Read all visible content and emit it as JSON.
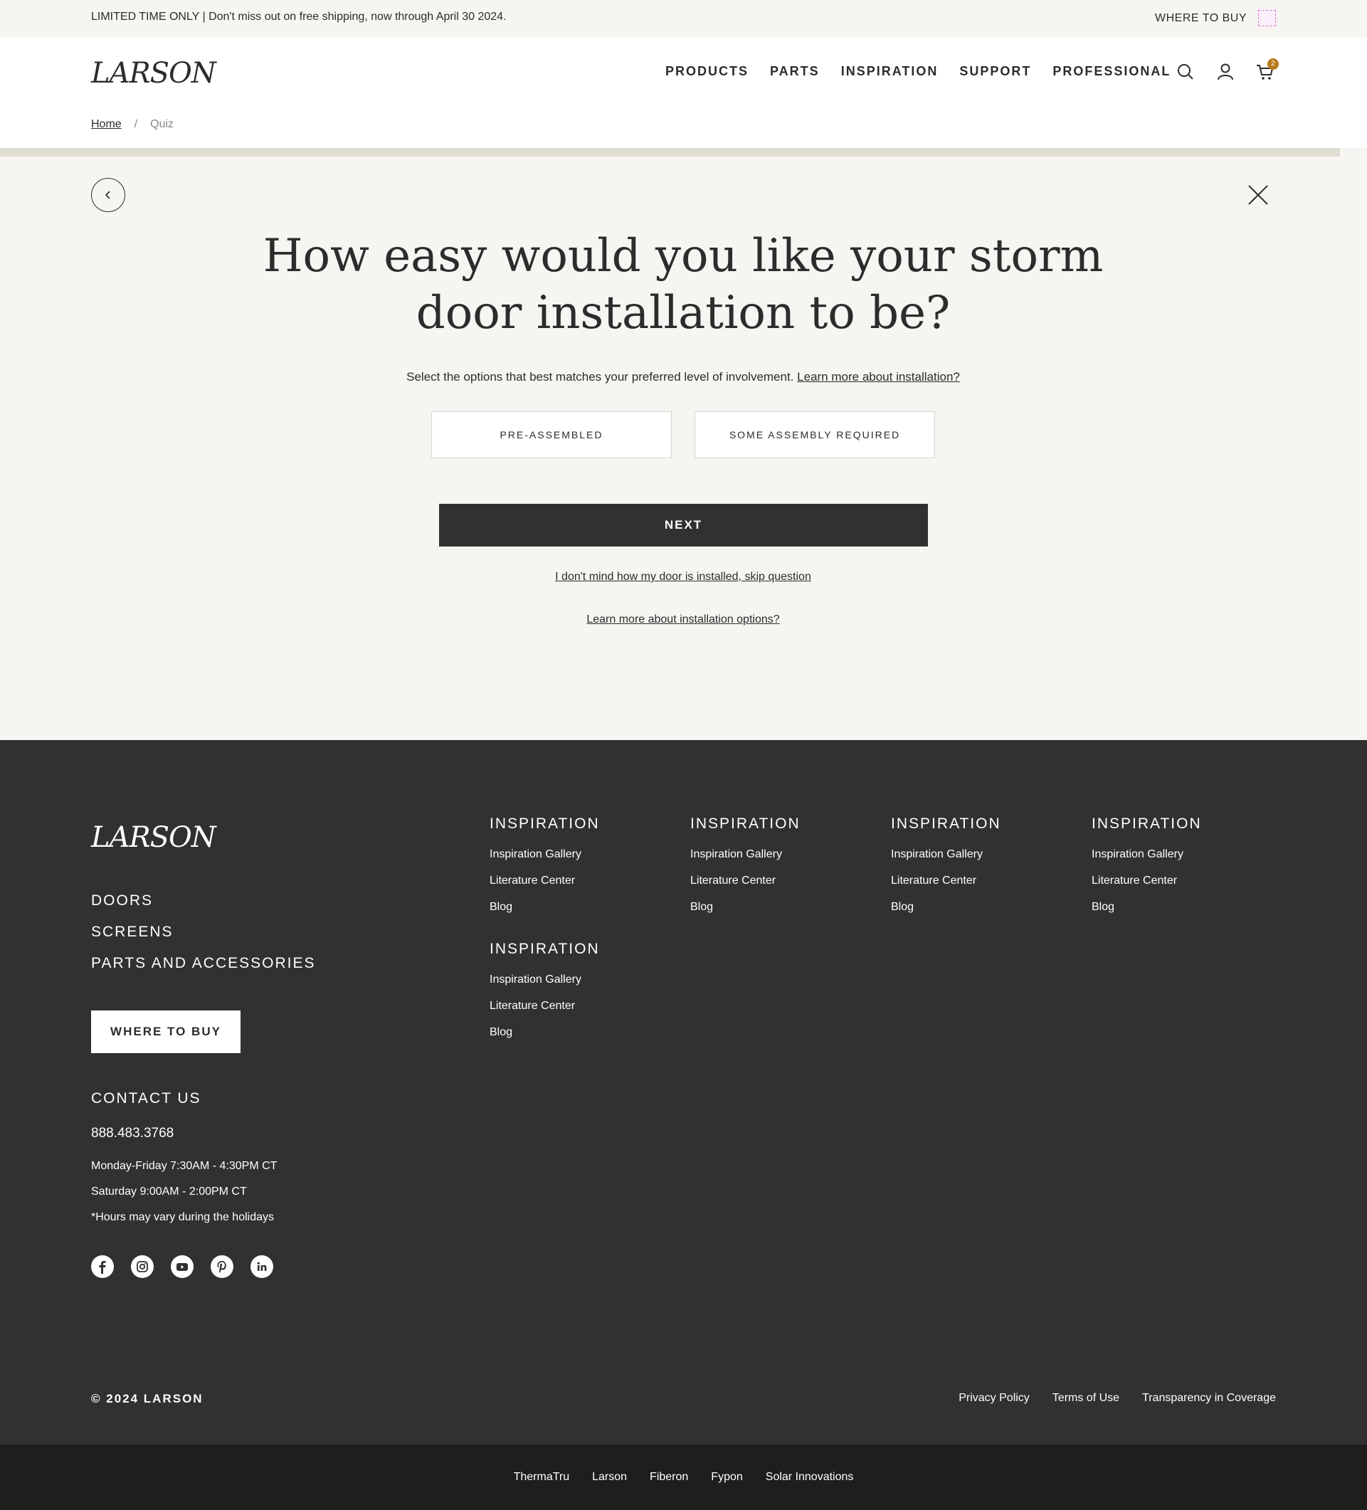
{
  "promo": {
    "text": "LIMITED TIME ONLY | Don't miss out on free shipping, now through April 30 2024.",
    "where_to_buy": "WHERE TO BUY"
  },
  "header": {
    "logo": "LARSON",
    "nav": [
      "PRODUCTS",
      "PARTS",
      "INSPIRATION",
      "SUPPORT",
      "PROFESSIONAL"
    ],
    "cart_count": "2",
    "icons": [
      "search-icon",
      "user-icon",
      "cart-icon"
    ]
  },
  "breadcrumb": {
    "home": "Home",
    "separator": "/",
    "current": "Quiz"
  },
  "quiz": {
    "progress": 0.98,
    "question": "How easy would you like your storm door installation to be?",
    "subtext": "Select the options that best matches your preferred level of involvement.",
    "subtext_link": "Learn more about installation?",
    "options": [
      "PRE-ASSEMBLED",
      "SOME ASSEMBLY REQUIRED"
    ],
    "next_label": "NEXT",
    "skip_label": "I don't mind how my door is installed, skip question",
    "learn_label": "Learn more about installation options?"
  },
  "footer": {
    "logo": "LARSON",
    "categories": [
      "DOORS",
      "SCREENS",
      "PARTS AND ACCESSORIES"
    ],
    "where_to_buy": "WHERE TO BUY",
    "contact_heading": "CONTACT US",
    "phone": "888.483.3768",
    "hours": [
      "Monday-Friday 7:30AM - 4:30PM CT",
      "Saturday 9:00AM - 2:00PM CT",
      "*Hours may vary during the holidays"
    ],
    "social": [
      "facebook-icon",
      "instagram-icon",
      "youtube-icon",
      "pinterest-icon",
      "linkedin-icon"
    ],
    "columns": [
      {
        "heading": "INSPIRATION",
        "links": [
          "Inspiration Gallery",
          "Literature Center",
          "Blog"
        ]
      },
      {
        "heading": "INSPIRATION",
        "links": [
          "Inspiration Gallery",
          "Literature Center",
          "Blog"
        ]
      },
      {
        "heading": "INSPIRATION",
        "links": [
          "Inspiration Gallery",
          "Literature Center",
          "Blog"
        ]
      },
      {
        "heading": "INSPIRATION",
        "links": [
          "Inspiration Gallery",
          "Literature Center",
          "Blog"
        ]
      },
      {
        "heading": "INSPIRATION",
        "links": [
          "Inspiration Gallery",
          "Literature Center",
          "Blog"
        ]
      }
    ],
    "copyright": "© 2024 LARSON",
    "legal": [
      "Privacy Policy",
      "Terms of Use",
      "Transparency in Coverage"
    ]
  },
  "brands": [
    "ThermaTru",
    "Larson",
    "Fiberon",
    "Fypon",
    "Solar Innovations"
  ]
}
